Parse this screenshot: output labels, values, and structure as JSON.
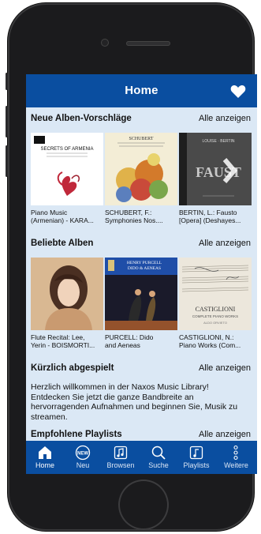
{
  "app": {
    "title": "Home"
  },
  "sections": {
    "new_albums": {
      "title": "Neue Alben-Vorschläge",
      "link": "Alle anzeigen",
      "albums": [
        {
          "cover_text": "SECRETS OF ARMENIA",
          "caption_line1": "Piano Music",
          "caption_line2": "(Armenian) - KARA..."
        },
        {
          "cover_text": "SCHUBERT",
          "caption_line1": "SCHUBERT, F.:",
          "caption_line2": "Symphonies Nos...."
        },
        {
          "cover_text": "FAUST",
          "caption_line1": "BERTIN, L.: Fausto",
          "caption_line2": "[Opera] (Deshayes..."
        }
      ]
    },
    "popular_albums": {
      "title": "Beliebte Alben",
      "link": "Alle anzeigen",
      "albums": [
        {
          "cover_text": "",
          "caption_line1": "Flute Recital: Lee,",
          "caption_line2": "Yerin - BOISMORTI..."
        },
        {
          "cover_text": "PURCELL",
          "caption_line1": "PURCELL: Dido",
          "caption_line2": "and Aeneas"
        },
        {
          "cover_text": "CASTIGLIONI",
          "caption_line1": "CASTIGLIONI, N.:",
          "caption_line2": "Piano Works (Com..."
        }
      ]
    },
    "recently_played": {
      "title": "Kürzlich abgespielt",
      "link": "Alle anzeigen",
      "lines": [
        "Herzlich willkommen in der Naxos Music Library!",
        "Entdecken Sie jetzt die ganze Bandbreite an",
        "hervorragenden Aufnahmen und beginnen Sie, Musik zu",
        "streamen."
      ]
    },
    "playlists": {
      "title": "Empfohlene Playlists",
      "link": "Alle anzeigen"
    }
  },
  "tabs": [
    {
      "label": "Home",
      "icon": "home-icon",
      "active": true
    },
    {
      "label": "Neu",
      "icon": "new-icon",
      "active": false
    },
    {
      "label": "Browsen",
      "icon": "browse-icon",
      "active": false
    },
    {
      "label": "Suche",
      "icon": "search-icon",
      "active": false
    },
    {
      "label": "Playlists",
      "icon": "playlists-icon",
      "active": false
    },
    {
      "label": "Weitere",
      "icon": "more-icon",
      "active": false
    }
  ],
  "colors": {
    "bar": "#0a4ea0",
    "screen_bg": "#dbe8f5",
    "phone_body": "#1b1b1d"
  }
}
